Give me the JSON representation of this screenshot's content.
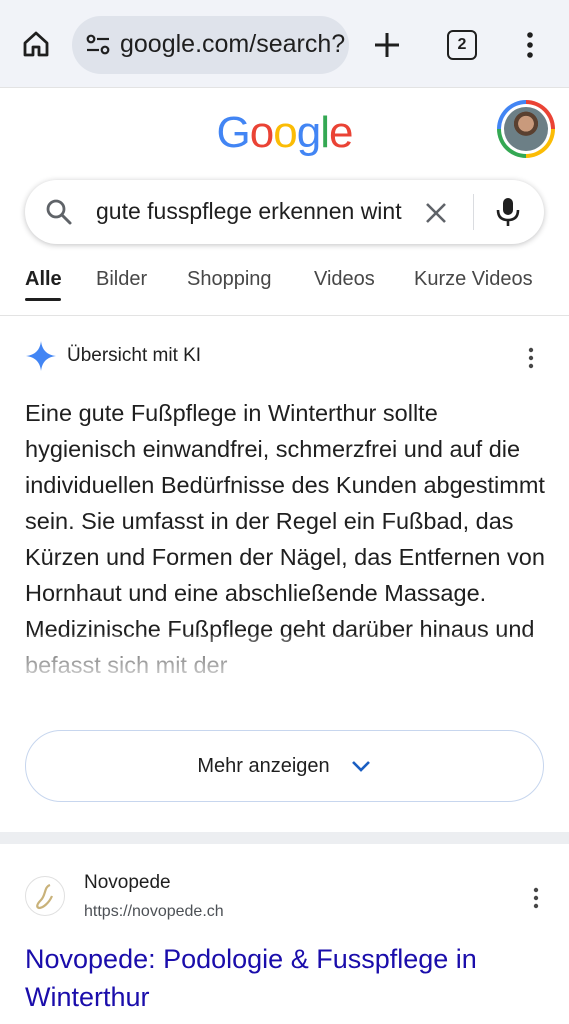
{
  "browser": {
    "url": "google.com/search?",
    "tab_count": "2",
    "icons": [
      "home-icon",
      "tune-icon",
      "plus-icon",
      "tabs-icon",
      "more-vert-icon"
    ]
  },
  "google": {
    "logo_letters": [
      "G",
      "o",
      "o",
      "g",
      "l",
      "e"
    ],
    "logo_colors": [
      "#4285f4",
      "#ea4335",
      "#fbbc05",
      "#4285f4",
      "#34a853",
      "#ea4335"
    ]
  },
  "search": {
    "query": "gute fusspflege erkennen winterthur",
    "icons": [
      "search-icon",
      "clear-icon",
      "mic-icon"
    ]
  },
  "tabs": [
    {
      "label": "Alle",
      "active": true
    },
    {
      "label": "Bilder",
      "active": false
    },
    {
      "label": "Shopping",
      "active": false
    },
    {
      "label": "Videos",
      "active": false
    },
    {
      "label": "Kurze Videos",
      "active": false
    }
  ],
  "ai_overview": {
    "title": "Übersicht mit KI",
    "text": "Eine gute Fußpflege in Winterthur sollte hygienisch einwandfrei, schmerzfrei und auf die individuellen Bedürfnisse des Kunden abgestimmt sein. Sie umfasst in der Regel ein Fußbad, das Kürzen und Formen der Nägel, das Entfernen von Hornhaut und eine abschließende Massage. Medizinische Fußpflege geht darüber hinaus und befasst sich mit der",
    "more_label": "Mehr anzeigen"
  },
  "result": {
    "site_name": "Novopede",
    "site_url": "https://novopede.ch",
    "title": "Novopede: Podologie & Fusspflege in Winterthur"
  },
  "colors": {
    "link": "#1a0dab",
    "sparkle": "#4285f4",
    "topbar": "#f1f3f8"
  }
}
